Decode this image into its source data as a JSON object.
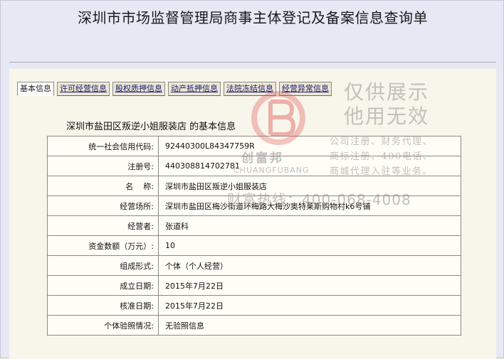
{
  "page": {
    "title": "深圳市市场监督管理局商事主体登记及备案信息查询单"
  },
  "tabs": [
    {
      "label": "基本信息"
    },
    {
      "label": "许可经营信息"
    },
    {
      "label": "股权质押信息"
    },
    {
      "label": "动产抵押信息"
    },
    {
      "label": "法院冻结信息"
    },
    {
      "label": "经营异常信息"
    }
  ],
  "section": {
    "title": "深圳市盐田区叛逆小姐服装店 的基本信息"
  },
  "info_rows": [
    {
      "key": "统一社会信用代码:",
      "value": "92440300L84347759R"
    },
    {
      "key": "注册号:",
      "value": "440308814702781"
    },
    {
      "key": "名    称:",
      "value": "深圳市盐田区叛逆小姐服装店"
    },
    {
      "key": "经营场所:",
      "value": "深圳市盐田区梅沙街道环梅路大梅沙奥特莱斯购物村k6号铺"
    },
    {
      "key": "经营者:",
      "value": "张道科"
    },
    {
      "key": "资金数额（万元）:",
      "value": "10"
    },
    {
      "key": "组成形式:",
      "value": "个体（个人经营）"
    },
    {
      "key": "成立日期:",
      "value": "2015年7月22日"
    },
    {
      "key": "核准日期:",
      "value": "2015年7月22日"
    },
    {
      "key": "个体验照情况:",
      "value": "无验照信息"
    }
  ],
  "watermark": {
    "line1": "仅供展示",
    "line2": "他用无效",
    "small1": "公司注册、财务代理、",
    "small2": "商标注册、400电话、",
    "small3": "商城代理入驻等业务。",
    "hotline": "财富热线：400-068-4008",
    "brand_cn": "创富邦",
    "brand_en": "CHUANGFUBANG",
    "logo_color": "#e05a5a"
  }
}
